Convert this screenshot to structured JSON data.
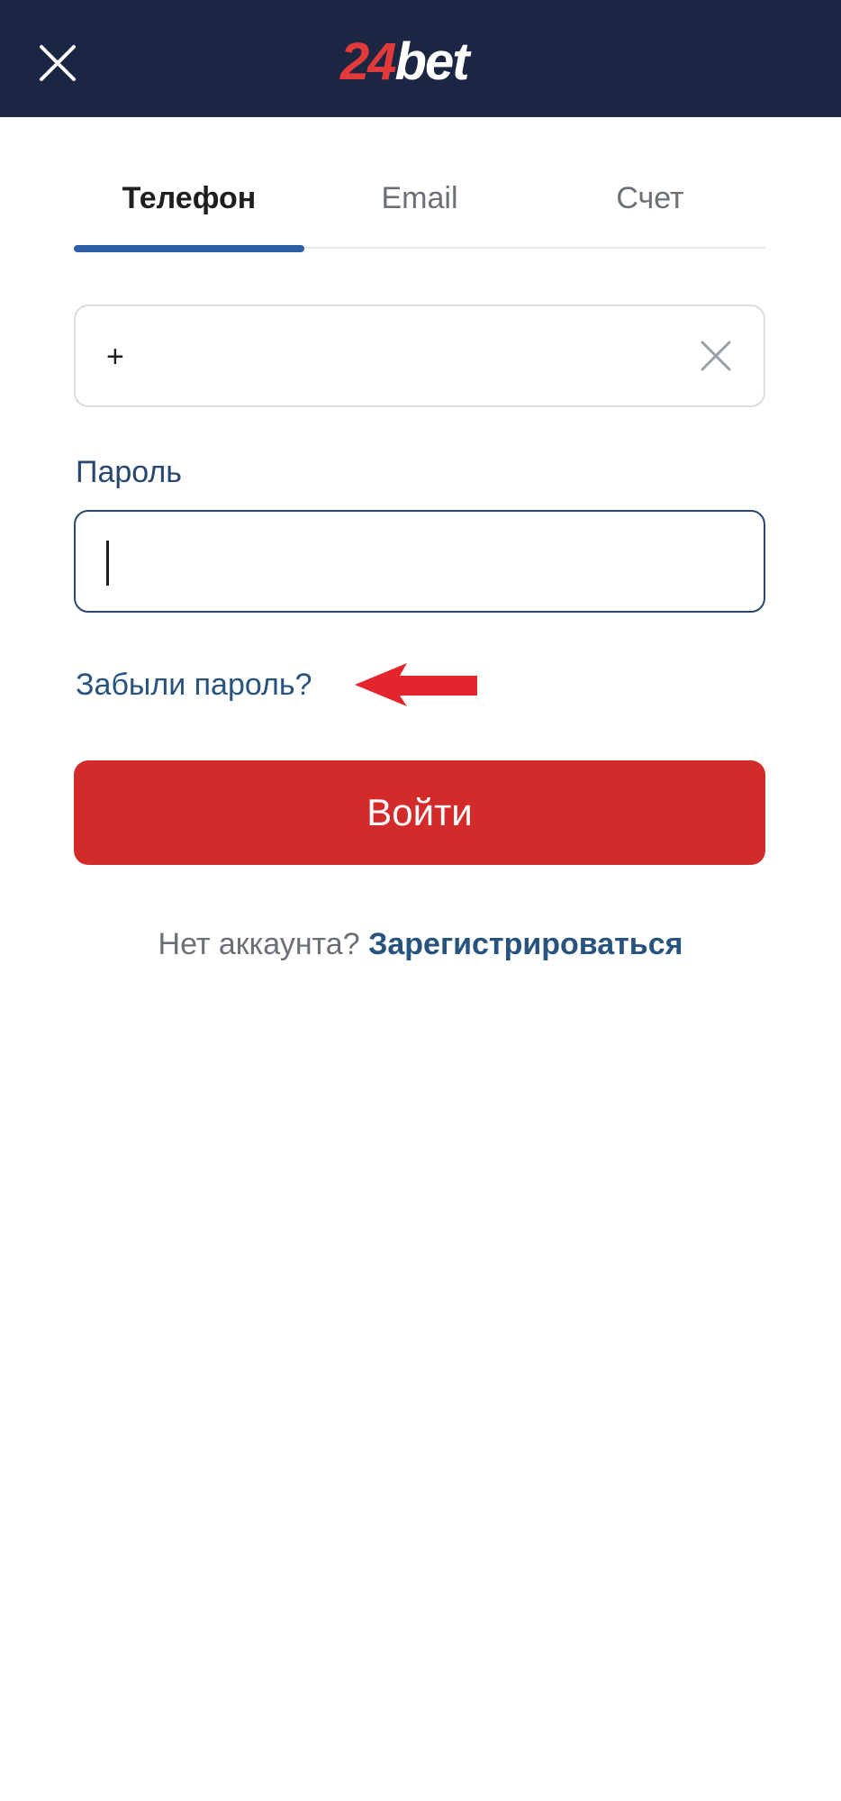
{
  "header": {
    "logo_number": "24",
    "logo_text": "bet",
    "close_icon": "close-icon"
  },
  "tabs": [
    {
      "label": "Телефон",
      "active": true
    },
    {
      "label": "Email",
      "active": false
    },
    {
      "label": "Счет",
      "active": false
    }
  ],
  "phone": {
    "value": "+",
    "clear_icon": "clear-icon"
  },
  "password": {
    "label": "Пароль",
    "value": ""
  },
  "forgot_link": "Забыли пароль?",
  "annotation": {
    "arrow_icon": "red-arrow-icon",
    "arrow_color": "#e3262b"
  },
  "login_button": "Войти",
  "signup": {
    "question": "Нет аккаунта?",
    "link": "Зарегистрироваться"
  },
  "colors": {
    "header_bg": "#1b2643",
    "brand_red": "#d32a2a",
    "accent_blue": "#2c5fa3"
  }
}
